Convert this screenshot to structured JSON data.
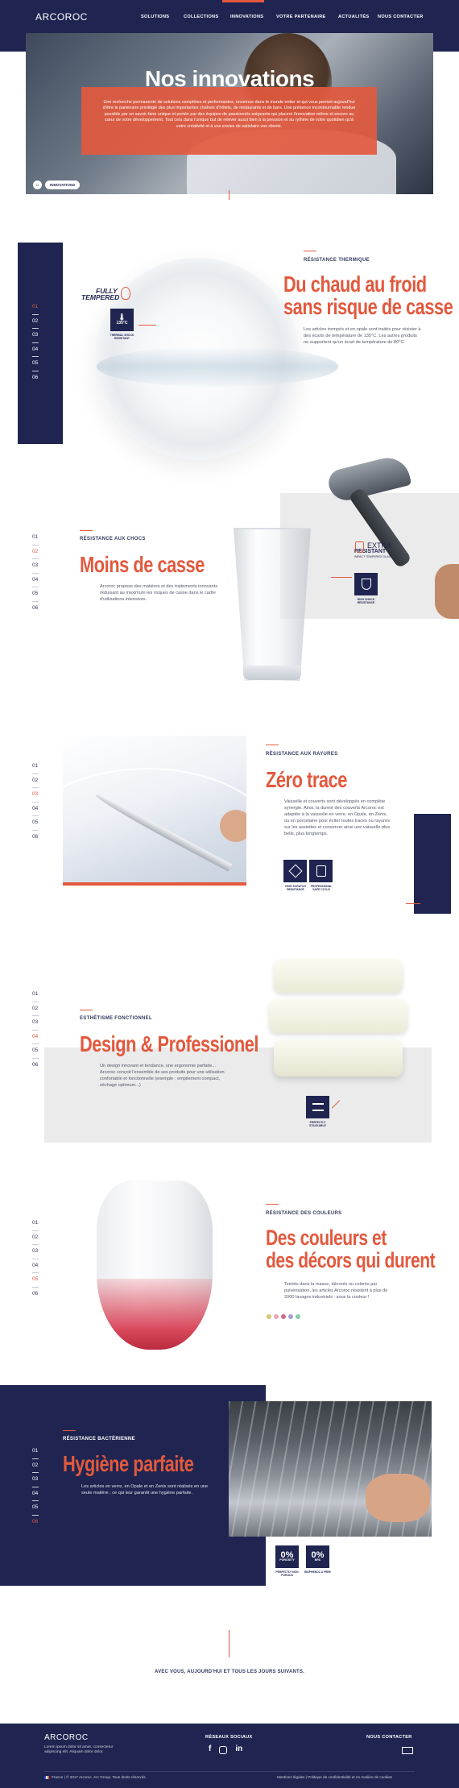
{
  "header": {
    "logo": "ARCOROC",
    "nav": [
      "SOLUTIONS",
      "COLLECTIONS",
      "INNOVATIONS",
      "VOTRE PARTENAIRE",
      "ACTUALITÉS",
      "NOUS CONTACTER"
    ],
    "active": "INNOVATIONS"
  },
  "hero": {
    "title": "Nos innovations",
    "text": "Une recherche permanente de solutions complètes et performantes, reconnue dans le monde entier et qui vous permet aujourd'hui d'être le partenaire privilégié des plus importantes chaînes d'hôtels, de restaurants et de bars. Une présence incontournable rendue possible par un savoir-faire unique et portée par des équipes de passionnés exigeants qui placent l'innovation même et encore au cœur de votre développement. Tout cela dans l'unique but de relever aussi bien à la pression et au rythme de votre quotidien qu'à votre créativité et à vos envies de satisfaire vos clients.",
    "breadcrumb": "INNOVATIONS"
  },
  "sections": [
    {
      "kicker": "RÉSISTANCE THERMIQUE",
      "title1": "Du chaud au froid",
      "title2": "sans risque de casse",
      "text": "Les articles trempés et en opale sont traités pour résister à des écarts de température de 135°C. Les autres produits ne supportent qu'un écart de température de 80°C.",
      "logo1": "FULLY",
      "logo2": "TEMPERED",
      "badge": "135°C",
      "badge_cap": "THERMAL SHOCK RESISTANT",
      "nav": [
        "01",
        "02",
        "03",
        "04",
        "05",
        "06"
      ],
      "active": 0
    },
    {
      "kicker": "RÉSISTANCE AUX CHOCS",
      "title1": "Moins de casse",
      "text": "Arcoroc propose des matières et des traitements innovants réduisant au maximum les risques de casse dans le cadre d'utilisations intensives.",
      "logo1": "EXTRA",
      "logo2": "RESISTANT",
      "logo3": "IMPACT TEMPERED GLASS",
      "badge_cap": "HIGH SHOCK RESISTANCE",
      "nav": [
        "01",
        "02",
        "03",
        "04",
        "05",
        "06"
      ],
      "active": 1
    },
    {
      "kicker": "RÉSISTANCE AUX RAYURES",
      "title1": "Zéro trace",
      "text": "Vaisselle et couverts sont développés en complète synergie. Ainsi, la dureté des couverts Arcoroc est adaptée à la vaisselle en verre, en Opale, en Zenix, ou en porcelaine pour éviter toutes traces ou rayures sur les assiettes et conserver ainsi une vaisselle plus belle, plus longtemps.",
      "badge_cap1": "HIGH SCRATCH RESISTANCE",
      "badge_cap2": "PROFESSIONAL SAFE CYCLE",
      "nav": [
        "01",
        "02",
        "03",
        "04",
        "05",
        "06"
      ],
      "active": 2
    },
    {
      "kicker": "ESTHÉTISME FONCTIONNEL",
      "title1": "Design & Professionel",
      "text": "Un design innovant et tendance, une ergonomie parfaite... Arcoroc conçoit l'ensemble de ses produits pour une utilisation confortable et fonctionnelle (exemple : empilement compact, séchage optimum...)",
      "badge_cap": "PERFECTLY STACKABLE",
      "nav": [
        "01",
        "02",
        "03",
        "04",
        "05",
        "06"
      ],
      "active": 3
    },
    {
      "kicker": "RÉSISTANCE DES COULEURS",
      "title1": "Des couleurs et",
      "title2": "des décors qui durent",
      "text": "Teintés dans la masse, décorés ou colorés par pulvérisation, les articles Arcoroc résistent à plus de 2000 lavages industriels : sous la couleur !",
      "swatches": [
        "#d9c57a",
        "#e6a8b0",
        "#d46b86",
        "#a7a0d4",
        "#8cc9a8"
      ],
      "nav": [
        "01",
        "02",
        "03",
        "04",
        "05",
        "06"
      ],
      "active": 4
    },
    {
      "kicker": "RÉSISTANCE BACTÉRIENNE",
      "title1": "Hygiène parfaite",
      "text": "Les articles en verre, en Opale et en Zenix sont réalisés en une seule matière ; ce qui leur garantit une hygiène parfaite.",
      "badge1": "0%",
      "badge1_sub": "POROSITY",
      "badge1_cap": "PERFECTLY NON POROUS",
      "badge2": "0%",
      "badge2_sub": "BPA",
      "badge2_cap": "BISPHENOL A FREE",
      "nav": [
        "01",
        "02",
        "03",
        "04",
        "05",
        "06"
      ],
      "active": 5
    }
  ],
  "tagline": "AVEC VOUS, AUJOURD'HUI ET TOUS LES JOURS SUIVANTS.",
  "footer": {
    "logo": "ARCOROC",
    "desc": "Lorem ipsum dolor sit amet, consectetur adipiscing elit. Aliquam dolor dolor.",
    "social_title": "RÉSEAUX SOCIAUX",
    "contact_title": "NOUS CONTACTER",
    "legal_left": "France  |  © 2017 Arcoroc. Arc Group. Tous droits réservés.",
    "legal_right": "Mentions légales  |  Politique de confidentialité et en matière de cookies"
  },
  "colors": {
    "navy": "#1f2550",
    "coral": "#e2593e",
    "gray": "#ebebeb"
  }
}
